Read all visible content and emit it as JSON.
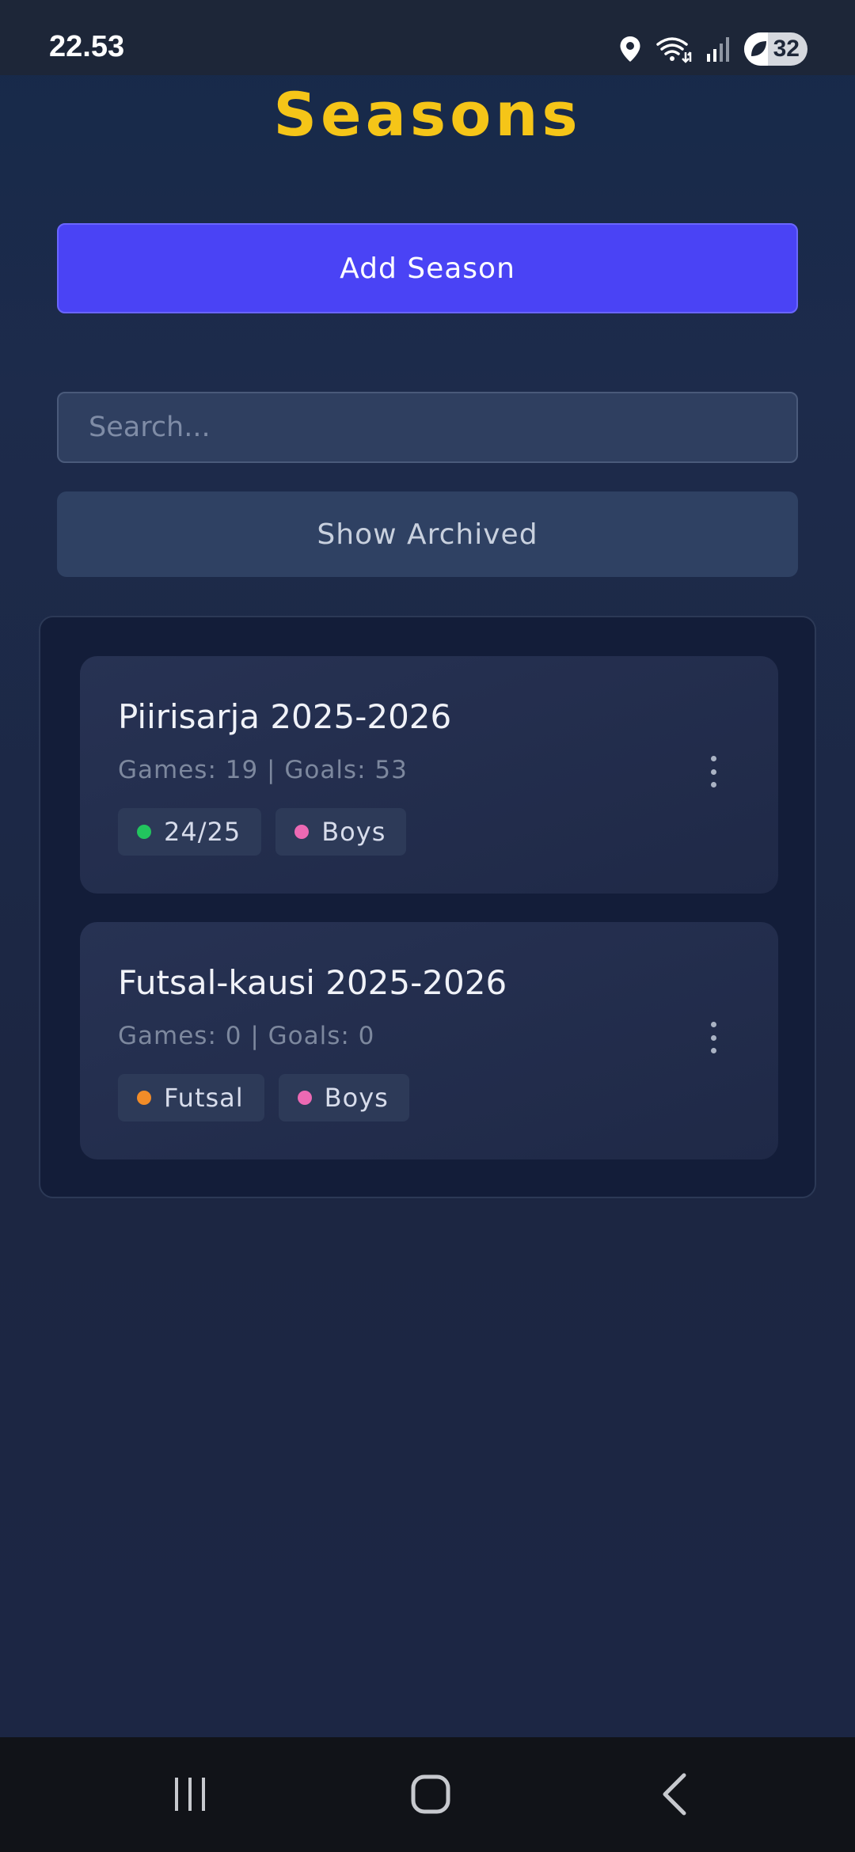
{
  "status_bar": {
    "time": "22.53",
    "battery_level": "32",
    "icons": [
      "location-icon",
      "wifi-icon",
      "signal-icon",
      "battery-icon"
    ]
  },
  "page": {
    "title": "Seasons",
    "title_color": "#f5c518"
  },
  "actions": {
    "add_season_label": "Add Season",
    "add_color": "#4a43f5",
    "search_placeholder": "Search...",
    "show_archived_label": "Show Archived"
  },
  "seasons": [
    {
      "name": "Piirisarja 2025-2026",
      "stats": "Games: 19 | Goals: 53",
      "tags": [
        {
          "label": "24/25",
          "color": "#22c55e"
        },
        {
          "label": "Boys",
          "color": "#ec69b3"
        }
      ]
    },
    {
      "name": "Futsal-kausi 2025-2026",
      "stats": "Games: 0 | Goals: 0",
      "tags": [
        {
          "label": "Futsal",
          "color": "#f28c28"
        },
        {
          "label": "Boys",
          "color": "#ec69b3"
        }
      ]
    }
  ],
  "nav": {
    "items": [
      "recent-apps-icon",
      "home-icon",
      "back-icon"
    ]
  }
}
